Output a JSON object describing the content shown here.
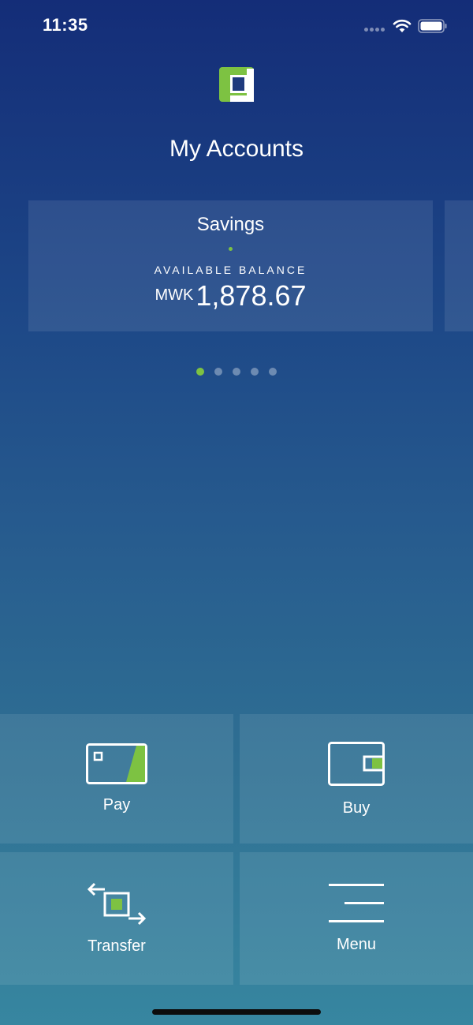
{
  "status_bar": {
    "time": "11:35",
    "icons": [
      "signal-dots-icon",
      "wifi-icon",
      "battery-icon"
    ]
  },
  "header": {
    "logo_icon": "bank-logo-icon",
    "title": "My Accounts"
  },
  "accounts": {
    "cards": [
      {
        "name": "Savings",
        "balance_label": "AVAILABLE BALANCE",
        "currency": "MWK",
        "balance": "1,878.67"
      }
    ],
    "pager": {
      "total": 5,
      "active_index": 0
    }
  },
  "actions": {
    "pay": {
      "label": "Pay",
      "icon": "card-icon"
    },
    "buy": {
      "label": "Buy",
      "icon": "wallet-icon"
    },
    "transfer": {
      "label": "Transfer",
      "icon": "transfer-arrows-icon"
    },
    "menu": {
      "label": "Menu",
      "icon": "hamburger-menu-icon"
    }
  },
  "colors": {
    "accent_green": "#7dc242",
    "background_top": "#142d78",
    "background_bottom": "#3786a0"
  }
}
